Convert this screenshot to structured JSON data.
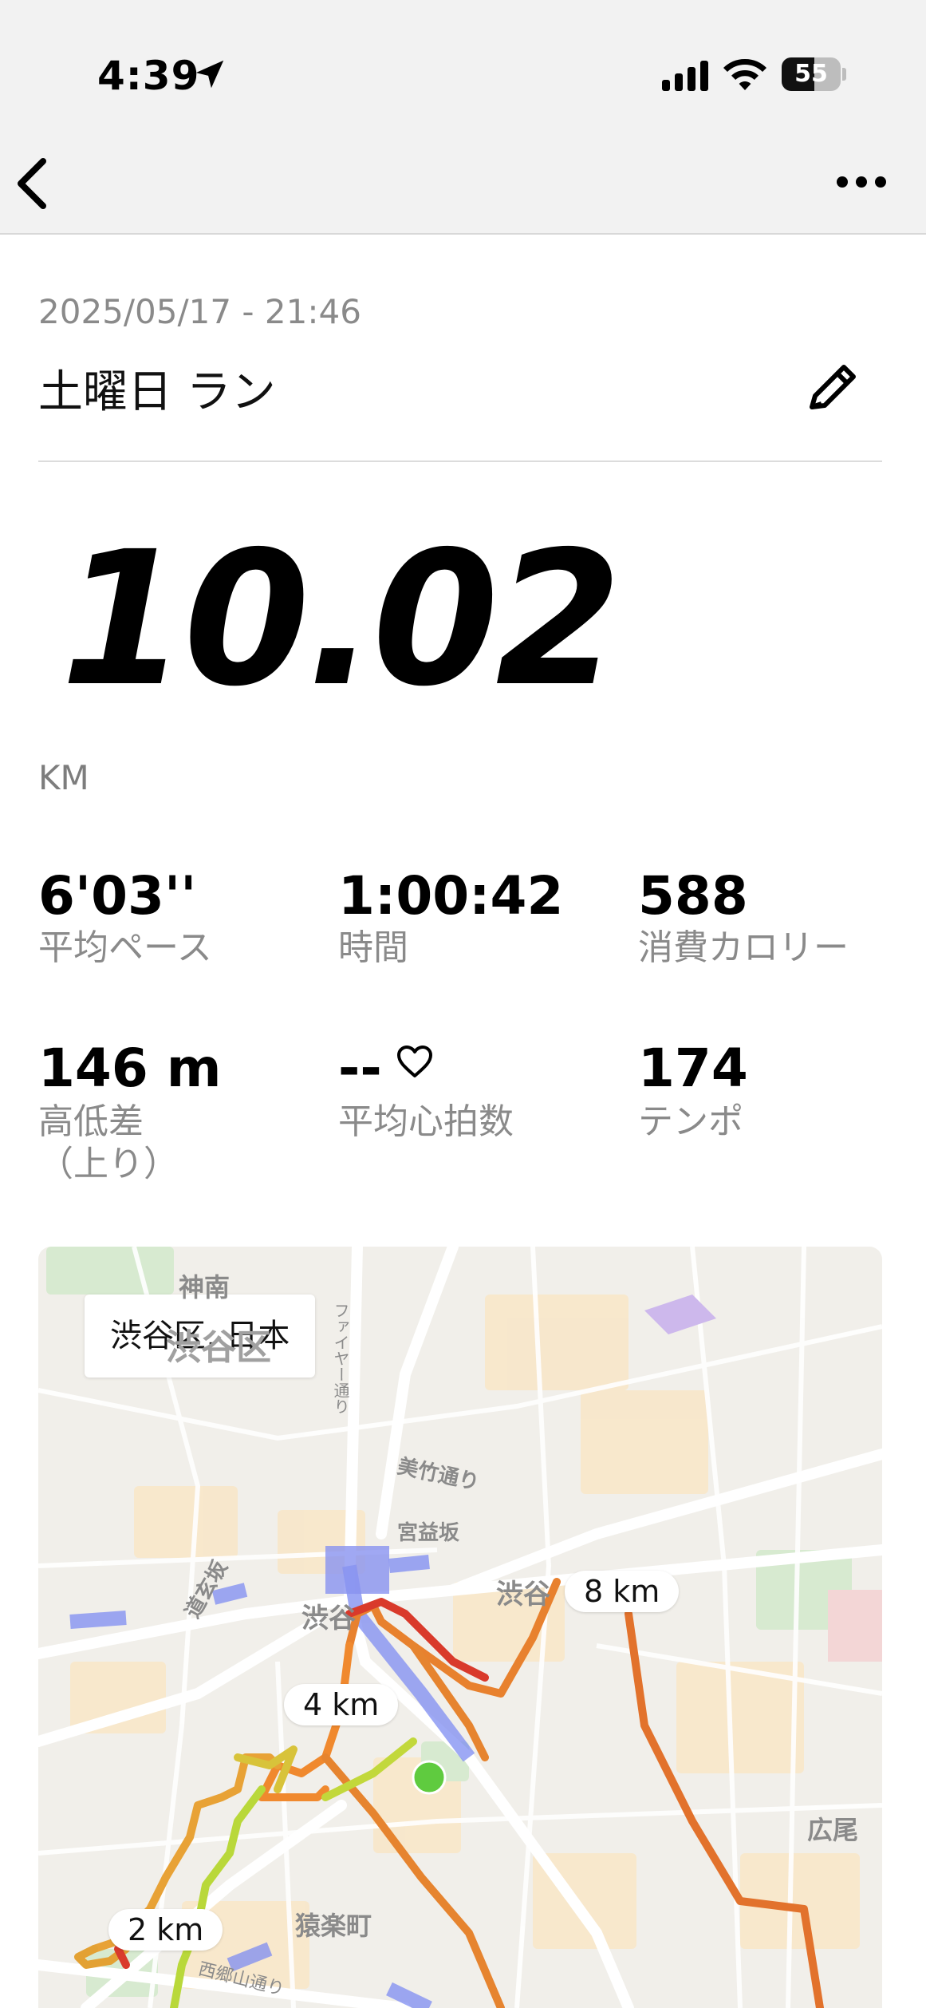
{
  "status_bar": {
    "time": "4:39",
    "battery": "55",
    "battery_level": 0.55,
    "icons": [
      "location-arrow-icon",
      "signal-icon",
      "wifi-icon",
      "battery-icon"
    ]
  },
  "nav": {
    "back_icon": "chevron-left-icon",
    "more_icon": "ellipsis-icon"
  },
  "activity": {
    "date": "2025/05/17 - 21:46",
    "title": "土曜日 ラン",
    "edit_icon": "pencil-icon",
    "distance": "10.02",
    "distance_unit": "KM"
  },
  "stats": [
    {
      "value": "6'03''",
      "label": "平均ペース"
    },
    {
      "value": "1:00:42",
      "label": "時間"
    },
    {
      "value": "588",
      "label": "消費カロリー"
    },
    {
      "value": "146 m",
      "label": "高低差\n（上り）"
    },
    {
      "value": "--",
      "label": "平均心拍数",
      "icon": "heart-icon"
    },
    {
      "value": "174",
      "label": "テンポ"
    }
  ],
  "map": {
    "location_label": "渋谷区, 日本",
    "km_markers": [
      "8 km",
      "4 km",
      "2 km"
    ],
    "place_names": [
      "神南",
      "渋谷区",
      "ファイヤー通り",
      "美竹通り",
      "宮益坂",
      "道玄坂",
      "渋谷",
      "渋谷",
      "広尾",
      "猿楽町",
      "西郷山通り"
    ],
    "colors": {
      "route_fast": "#f0892e",
      "route_mid": "#e8c233",
      "route_slow": "#a8d63b",
      "route_hot": "#d93a2b",
      "start_dot": "#5fcb3f",
      "rail": "#7d8cf2"
    }
  }
}
